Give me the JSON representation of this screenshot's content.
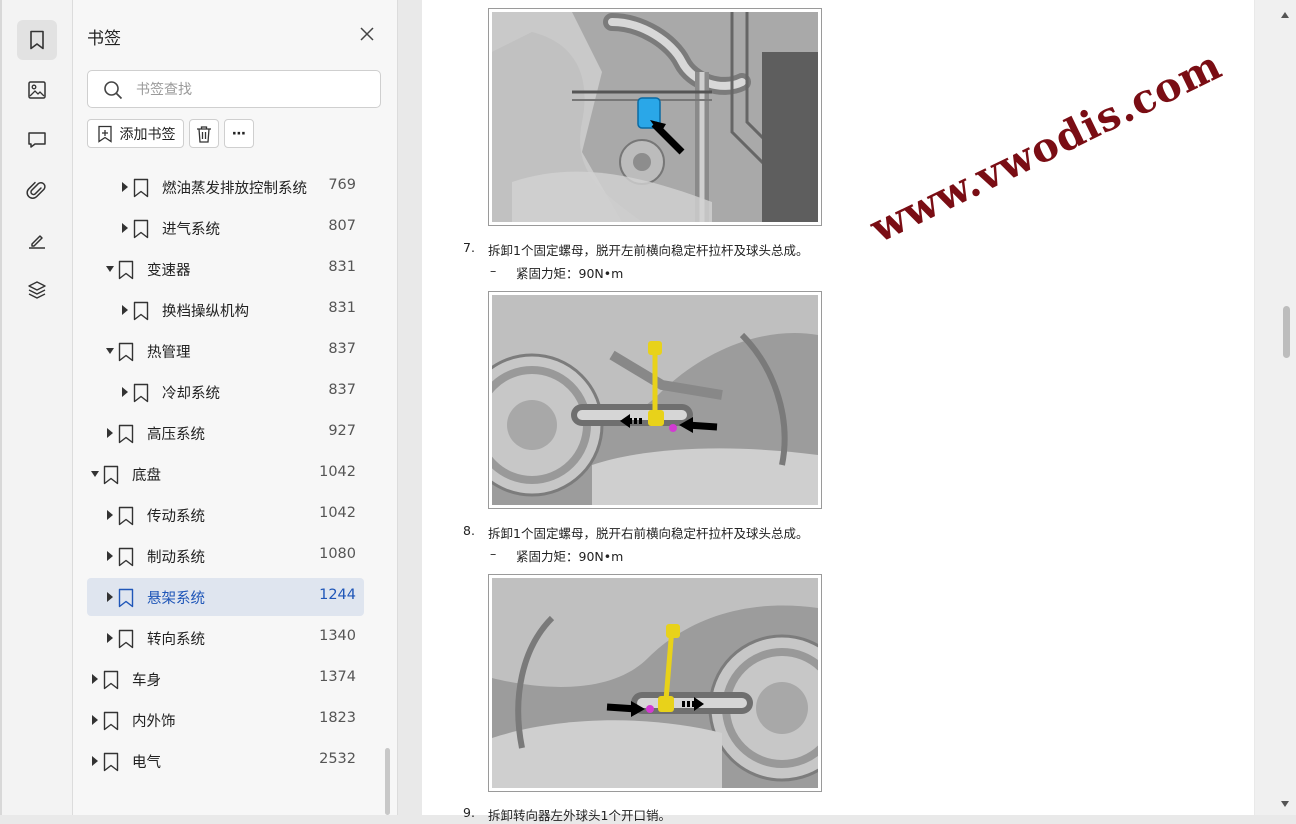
{
  "rail": {
    "items": [
      {
        "icon": "bookmark-icon",
        "active": true
      },
      {
        "icon": "image-icon",
        "active": false
      },
      {
        "icon": "comment-icon",
        "active": false
      },
      {
        "icon": "attachment-icon",
        "active": false
      },
      {
        "icon": "signature-icon",
        "active": false
      },
      {
        "icon": "layers-icon",
        "active": false
      }
    ]
  },
  "panel": {
    "title": "书签",
    "search_placeholder": "书签查找",
    "add_bookmark_label": "添加书签",
    "more_label": "⋯"
  },
  "bookmarks": [
    {
      "label": "燃油蒸发排放控制系统",
      "page": "769",
      "level": 2,
      "expanded": false,
      "selected": false
    },
    {
      "label": "进气系统",
      "page": "807",
      "level": 2,
      "expanded": false,
      "selected": false
    },
    {
      "label": "变速器",
      "page": "831",
      "level": 1,
      "expanded": true,
      "selected": false
    },
    {
      "label": "换档操纵机构",
      "page": "831",
      "level": 2,
      "expanded": false,
      "selected": false
    },
    {
      "label": "热管理",
      "page": "837",
      "level": 1,
      "expanded": true,
      "selected": false
    },
    {
      "label": "冷却系统",
      "page": "837",
      "level": 2,
      "expanded": false,
      "selected": false
    },
    {
      "label": "高压系统",
      "page": "927",
      "level": 1,
      "expanded": false,
      "selected": false
    },
    {
      "label": "底盘",
      "page": "1042",
      "level": 0,
      "expanded": true,
      "selected": false
    },
    {
      "label": "传动系统",
      "page": "1042",
      "level": 1,
      "expanded": false,
      "selected": false
    },
    {
      "label": "制动系统",
      "page": "1080",
      "level": 1,
      "expanded": false,
      "selected": false
    },
    {
      "label": "悬架系统",
      "page": "1244",
      "level": 1,
      "expanded": false,
      "selected": true
    },
    {
      "label": "转向系统",
      "page": "1340",
      "level": 1,
      "expanded": false,
      "selected": false
    },
    {
      "label": "车身",
      "page": "1374",
      "level": 0,
      "expanded": false,
      "selected": false
    },
    {
      "label": "内外饰",
      "page": "1823",
      "level": 0,
      "expanded": false,
      "selected": false
    },
    {
      "label": "电气",
      "page": "2532",
      "level": 0,
      "expanded": false,
      "selected": false
    }
  ],
  "document": {
    "steps": [
      {
        "num": "7.",
        "text": "拆卸1个固定螺母，脱开左前横向稳定杆拉杆及球头总成。",
        "torque_dash": "–",
        "torque": "紧固力矩：90N•m"
      },
      {
        "num": "8.",
        "text": "拆卸1个固定螺母，脱开右前横向稳定杆拉杆及球头总成。",
        "torque_dash": "–",
        "torque": "紧固力矩：90N•m"
      },
      {
        "num": "9.",
        "text": "拆卸转向器左外球头1个开口销。"
      }
    ],
    "watermark": "www.vwodis.com"
  },
  "colors": {
    "selected_bg": "#dfe5ef",
    "selected_text": "#1f56b8",
    "watermark": "#7a0d14",
    "highlight_blue": "#2aa7e8",
    "highlight_yellow": "#e8d21a",
    "highlight_magenta": "#d23bd2"
  }
}
